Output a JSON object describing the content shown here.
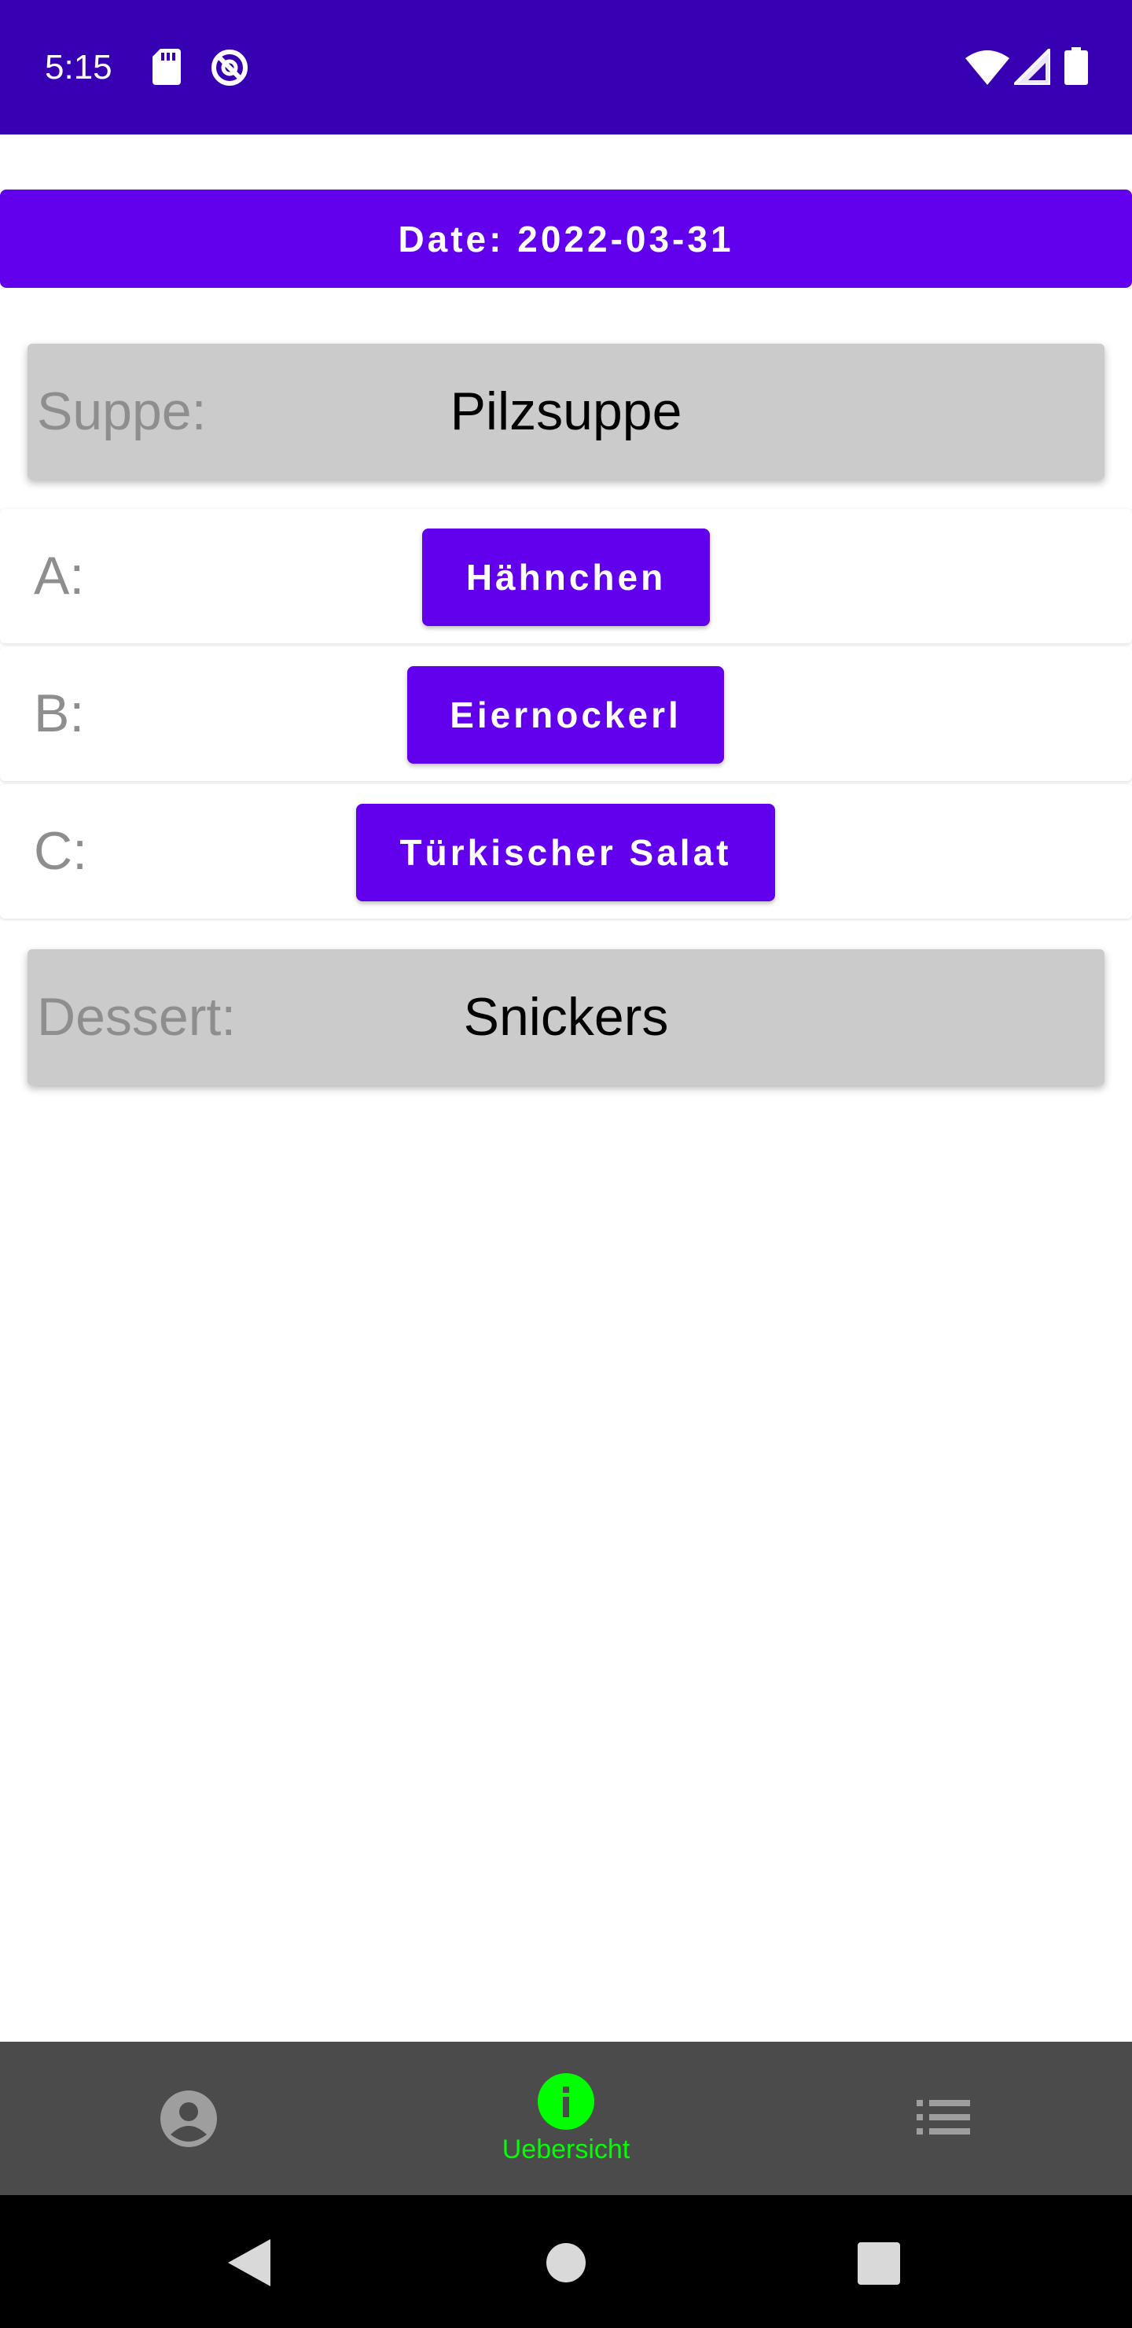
{
  "status_bar": {
    "time": "5:15",
    "icons": [
      "sd-card-icon",
      "sync-icon",
      "wifi-icon",
      "signal-icon",
      "battery-icon"
    ]
  },
  "date_bar": {
    "text": "Date: 2022-03-31"
  },
  "menu": {
    "soup": {
      "label": "Suppe:",
      "value": "Pilzsuppe"
    },
    "options": [
      {
        "label": "A:",
        "dish": "Hähnchen"
      },
      {
        "label": "B:",
        "dish": "Eiernockerl"
      },
      {
        "label": "C:",
        "dish": "Türkischer Salat"
      }
    ],
    "dessert": {
      "label": "Dessert:",
      "value": "Snickers"
    }
  },
  "bottom_nav": {
    "items": [
      {
        "icon": "account-icon",
        "label": "",
        "active": false
      },
      {
        "icon": "info-icon",
        "label": "Uebersicht",
        "active": true
      },
      {
        "icon": "list-icon",
        "label": "",
        "active": false
      }
    ]
  },
  "system_nav": {
    "icons": [
      "back-icon",
      "home-icon",
      "recents-icon"
    ]
  },
  "colors": {
    "status_bar": "#3700b3",
    "primary": "#6200ee",
    "active_nav": "#00ff00",
    "nav_background": "#4b4b4b",
    "card_background": "#cbcbcb"
  }
}
